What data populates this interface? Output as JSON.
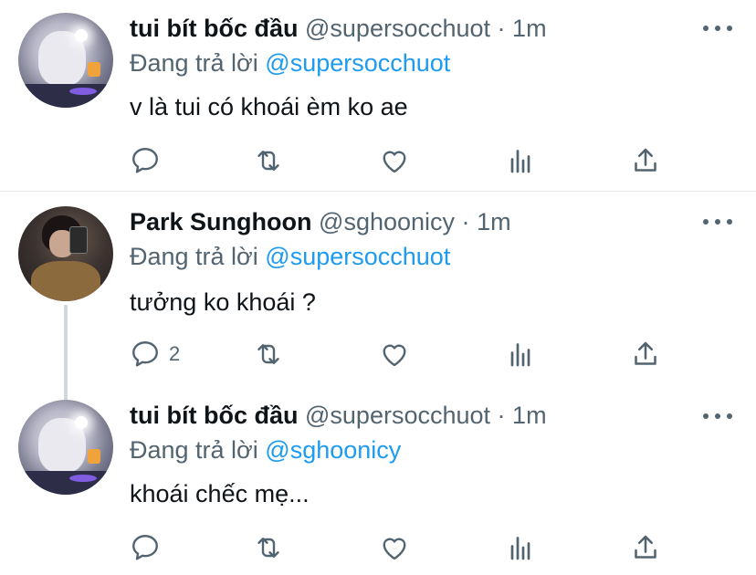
{
  "tweets": [
    {
      "name": "tui bít bốc đầu",
      "handle": "@supersocchuot",
      "sep": "·",
      "time": "1m",
      "reply_prefix": "Đang trả lời",
      "reply_to": "@supersocchuot",
      "text": "v là tui có khoái èm ko ae",
      "reply_count": ""
    },
    {
      "name": "Park Sunghoon",
      "handle": "@sghoonicy",
      "sep": "·",
      "time": "1m",
      "reply_prefix": "Đang trả lời",
      "reply_to": "@supersocchuot",
      "text": "tưởng ko khoái ?",
      "reply_count": "2"
    },
    {
      "name": "tui bít bốc đầu",
      "handle": "@supersocchuot",
      "sep": "·",
      "time": "1m",
      "reply_prefix": "Đang trả lời",
      "reply_to": "@sghoonicy",
      "text": "khoái chếc mẹ...",
      "reply_count": ""
    }
  ],
  "icons": {
    "reply": "reply-icon",
    "retweet": "retweet-icon",
    "like": "like-icon",
    "analytics": "analytics-icon",
    "share": "share-icon",
    "more": "more-icon"
  },
  "colors": {
    "text": "#0f1419",
    "secondary": "#536471",
    "mention": "#1d9bf0",
    "divider": "#e6ecf0",
    "thread_line": "#cfd9de"
  }
}
